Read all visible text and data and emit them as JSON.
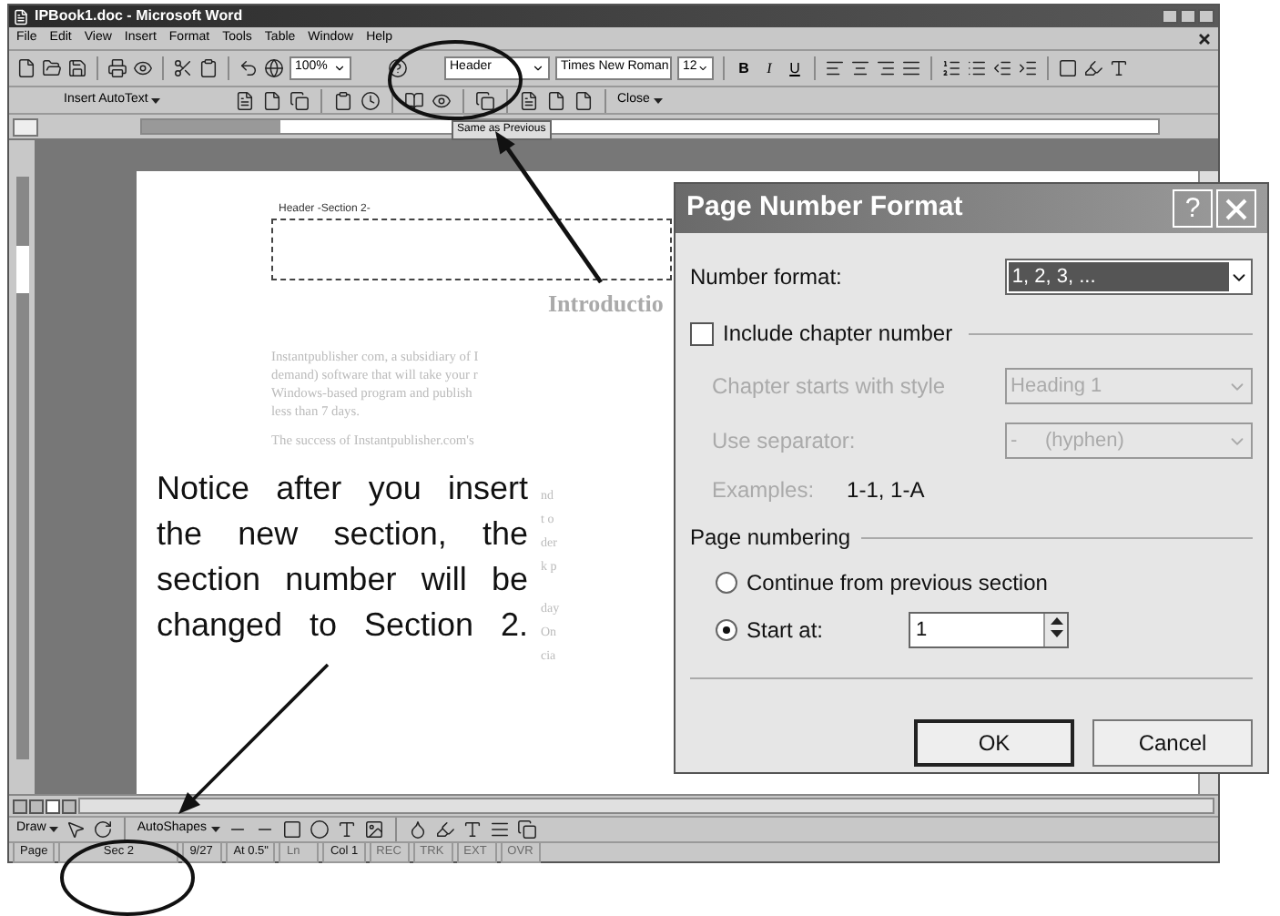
{
  "window": {
    "title": "IPBook1.doc - Microsoft Word"
  },
  "menu": [
    "File",
    "Edit",
    "View",
    "Insert",
    "Format",
    "Tools",
    "Table",
    "Window",
    "Help"
  ],
  "standard_toolbar": {
    "zoom": "100%",
    "style": "Header",
    "font": "Times New Roman",
    "size": "12",
    "format_buttons": [
      "B",
      "I",
      "U"
    ]
  },
  "header_footer_toolbar": {
    "autotext": "Insert AutoText",
    "close": "Close"
  },
  "ruler": {
    "tag": "Same as Previous"
  },
  "document": {
    "header_label": "Header -Section 2-",
    "heading": "Introductio",
    "paragraph_1": [
      "Instantpublisher com, a subsidiary of I",
      "demand) software that will take your r",
      "Windows-based program and publish",
      "less than 7 days."
    ],
    "paragraph_2": [
      "The success of Instantpublisher.com's"
    ],
    "fragment_groups": [
      [
        "nd",
        "t o",
        "der",
        "k p"
      ],
      [
        "day",
        "On",
        "cia"
      ]
    ]
  },
  "note": "Notice after you insert the new section, the section number will be changed to Section 2.",
  "dialog": {
    "title": "Page Number Format",
    "help": "?",
    "number_format": {
      "label": "Number format:",
      "value": "1, 2, 3, ..."
    },
    "include_chapter": {
      "label": "Include chapter number",
      "checked": false
    },
    "chapter_style": {
      "label": "Chapter starts with style",
      "value": "Heading 1",
      "disabled": true
    },
    "separator": {
      "label": "Use separator:",
      "value": "-     (hyphen)",
      "disabled": true
    },
    "examples": {
      "label": "Examples:",
      "value": "1-1, 1-A",
      "disabled": true
    },
    "page_numbering": {
      "label": "Page numbering",
      "options": [
        {
          "label": "Continue from previous section",
          "selected": false
        },
        {
          "label": "Start at:",
          "selected": true,
          "value": "1"
        }
      ]
    },
    "buttons": [
      "OK",
      "Cancel"
    ]
  },
  "drawing_toolbar": {
    "draw": "Draw",
    "autoshapes": "AutoShapes"
  },
  "status_bar": [
    {
      "text": "Page",
      "disabled": false
    },
    {
      "text": "Sec 2",
      "disabled": false
    },
    {
      "text": "9/27",
      "disabled": false
    },
    {
      "text": "At 0.5\"",
      "disabled": false
    },
    {
      "text": "Ln",
      "disabled": true
    },
    {
      "text": "Col 1",
      "disabled": false
    },
    {
      "text": "REC",
      "disabled": true
    },
    {
      "text": "TRK",
      "disabled": true
    },
    {
      "text": "EXT",
      "disabled": true
    },
    {
      "text": "OVR",
      "disabled": true
    }
  ]
}
